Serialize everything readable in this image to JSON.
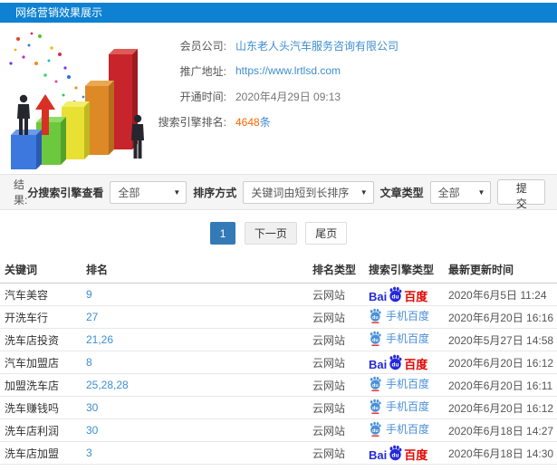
{
  "header": {
    "title": "网络营销效果展示"
  },
  "info": {
    "fields": [
      {
        "label": "会员公司:",
        "value": "山东老人头汽车服务咨询有限公司"
      },
      {
        "label": "推广地址:",
        "value": "https://www.lrtlsd.com"
      },
      {
        "label": "开通时间:",
        "value": "2020年4月29日 09:13"
      },
      {
        "label": "搜索引擎排名:",
        "value": "4648",
        "suffix": "条"
      }
    ]
  },
  "filter": {
    "result_label": "结果:",
    "engine_filter_label": "分搜索引擎查看",
    "engine_filter_value": "全部",
    "sort_label": "排序方式",
    "sort_value": "关键词由短到长排序",
    "article_type_label": "文章类型",
    "article_type_value": "全部",
    "submit_label": "提交"
  },
  "pagination": {
    "current": "1",
    "next": "下一页",
    "last": "尾页"
  },
  "table": {
    "columns": [
      "关键词",
      "排名",
      "排名类型",
      "搜索引擎类型",
      "最新更新时间"
    ],
    "rows": [
      {
        "keyword": "汽车美容",
        "rank": "9",
        "rank_type": "云网站",
        "engine": "baidu",
        "updated": "2020年6月5日 11:24"
      },
      {
        "keyword": "开洗车行",
        "rank": "27",
        "rank_type": "云网站",
        "engine": "mobile-baidu",
        "updated": "2020年6月20日 16:16"
      },
      {
        "keyword": "洗车店投资",
        "rank": "21,26",
        "rank_type": "云网站",
        "engine": "mobile-baidu",
        "updated": "2020年5月27日 14:58"
      },
      {
        "keyword": "汽车加盟店",
        "rank": "8",
        "rank_type": "云网站",
        "engine": "baidu",
        "updated": "2020年6月20日 16:12"
      },
      {
        "keyword": "加盟洗车店",
        "rank": "25,28,28",
        "rank_type": "云网站",
        "engine": "mobile-baidu",
        "updated": "2020年6月20日 16:11"
      },
      {
        "keyword": "洗车赚钱吗",
        "rank": "30",
        "rank_type": "云网站",
        "engine": "mobile-baidu",
        "updated": "2020年6月20日 16:12"
      },
      {
        "keyword": "洗车店利润",
        "rank": "30",
        "rank_type": "云网站",
        "engine": "mobile-baidu",
        "updated": "2020年6月18日 14:27"
      },
      {
        "keyword": "洗车店加盟",
        "rank": "3",
        "rank_type": "云网站",
        "engine": "baidu",
        "updated": "2020年6月18日 14:30"
      }
    ]
  },
  "engines": {
    "baidu": {
      "name": "百度",
      "text_bai": "Bai",
      "text_du": "du",
      "text_cn": "百度"
    },
    "mobile-baidu": {
      "name": "手机百度",
      "label": "手机百度",
      "text_du": "du"
    }
  },
  "colors": {
    "topbar_blue": "#0e81d2",
    "link_blue": "#3e8ed0",
    "highlight_orange": "#ff6600",
    "active_page_blue": "#337ab7",
    "baidu_blue": "#2529d8",
    "baidu_red": "#e10602",
    "mobile_baidu_blue": "#4a90d9"
  }
}
